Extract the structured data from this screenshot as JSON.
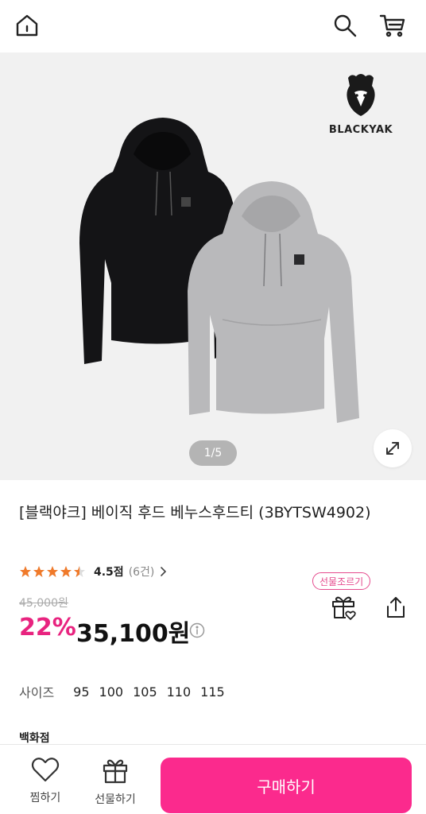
{
  "header": {
    "icons": [
      "home-icon",
      "search-icon",
      "cart-icon"
    ]
  },
  "gallery": {
    "brand_logo_text": "BLACKYAK",
    "pager": "1/5",
    "current_page": 1,
    "total_pages": 5
  },
  "product": {
    "title": "[블랙야크] 베이직 후드 베누스후드티 (3BYTSW4902)",
    "rating_stars": 4.5,
    "rating_text": "4.5점",
    "review_count": "(6건)",
    "original_price": "45,000원",
    "discount": "22%",
    "price": "35,100원"
  },
  "actions": {
    "gift_badge": "선물조르기"
  },
  "options": {
    "size_label": "사이즈",
    "sizes": [
      "95",
      "100",
      "105",
      "110",
      "115"
    ]
  },
  "next_section_label": "백화점",
  "bottom_bar": {
    "wish_label": "찜하기",
    "gift_label": "선물하기",
    "buy_label": "구매하기"
  },
  "colors": {
    "accent_pink": "#fb2a8d",
    "discount_pink": "#e8237f",
    "star_orange": "#f07a2a"
  }
}
